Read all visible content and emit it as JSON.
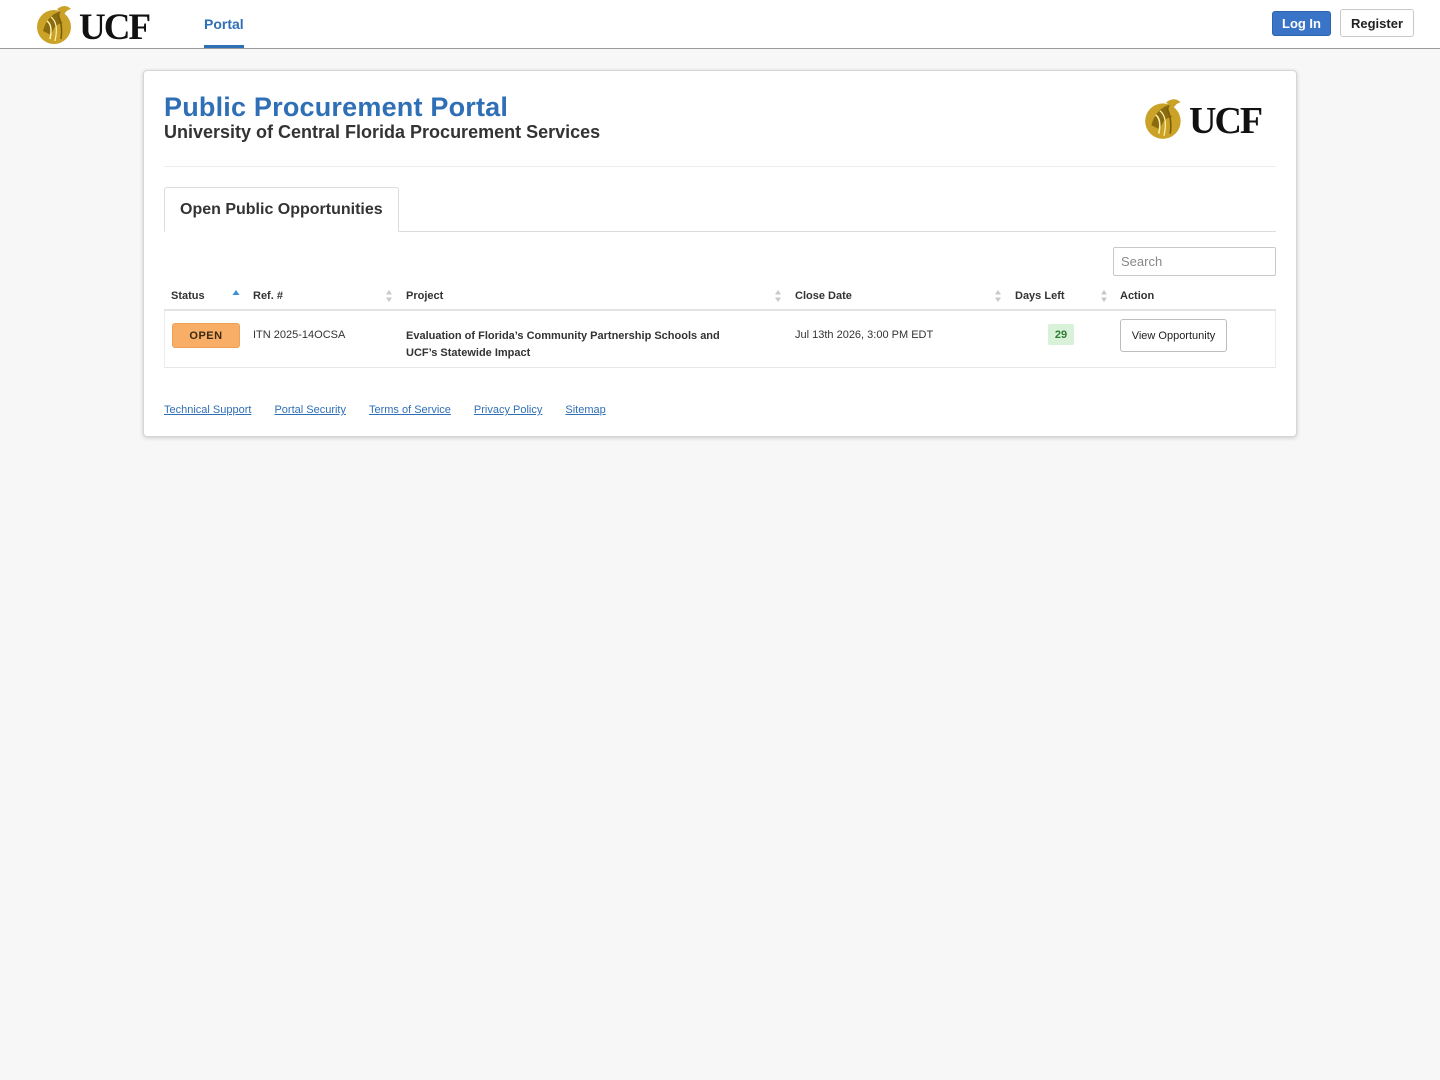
{
  "topbar": {
    "logo_text": "UCF",
    "nav_portal": "Portal",
    "login_label": "Log In",
    "register_label": "Register"
  },
  "header": {
    "title": "Public Procurement Portal",
    "subtitle": "University of Central Florida Procurement Services",
    "logo_text": "UCF"
  },
  "tabs": [
    {
      "label": "Open Public Opportunities",
      "active": true
    }
  ],
  "search": {
    "placeholder": "Search",
    "value": ""
  },
  "table": {
    "columns": [
      "Status",
      "Ref. #",
      "Project",
      "Close Date",
      "Days Left",
      "Action"
    ],
    "sorted_column": "Status",
    "rows": [
      {
        "status": "OPEN",
        "ref": "ITN 2025-14OCSA",
        "project_line1": "Evaluation of Florida’s Community Partnership Schools and",
        "project_line2": "UCF’s Statewide Impact",
        "close_date": "Jul 13th 2026, 3:00 PM EDT",
        "days_left": "29",
        "action_label": "View Opportunity"
      }
    ]
  },
  "footer": {
    "links": [
      "Technical Support",
      "Portal Security",
      "Terms of Service",
      "Privacy Policy",
      "Sitemap"
    ]
  },
  "colors": {
    "accent": "#2f6fb6",
    "open_badge": "#f9ae68",
    "days_badge": "#d9f0d9",
    "logo_gold": "#c9a227",
    "background": "#f7f7f7"
  }
}
